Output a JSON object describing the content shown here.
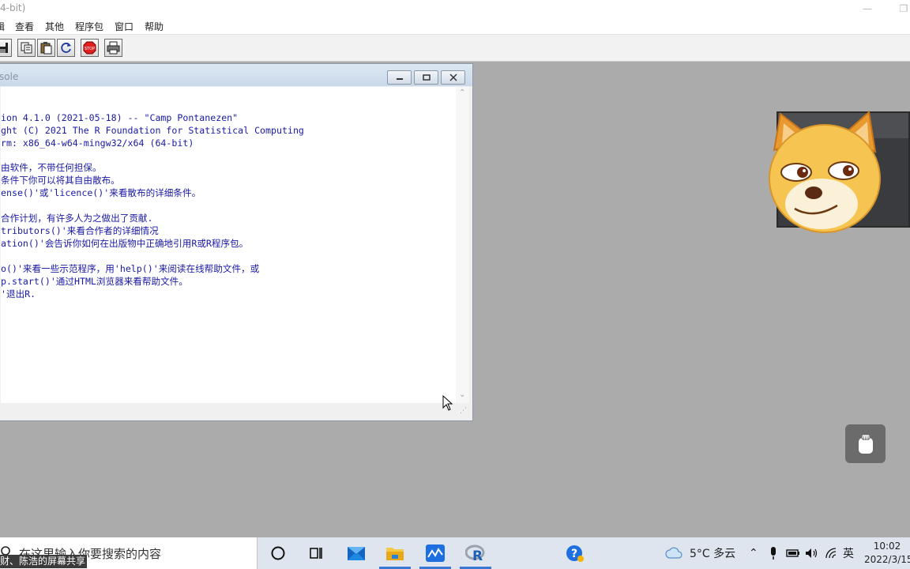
{
  "app": {
    "title_fragment": "4-bit)",
    "accent_color": "#1a1aa6"
  },
  "menu": {
    "items": [
      "辑",
      "查看",
      "其他",
      "程序包",
      "窗口",
      "帮助"
    ]
  },
  "toolbar": {
    "buttons": [
      "save-icon",
      "copy-icon",
      "paste-icon",
      "refresh-icon",
      "stop-icon",
      "print-icon"
    ]
  },
  "console": {
    "title": "sole",
    "lines": [
      "ion 4.1.0 (2021-05-18) -- \"Camp Pontanezen\"",
      "ght (C) 2021 The R Foundation for Statistical Computing",
      "rm: x86_64-w64-mingw32/x64 (64-bit)",
      "",
      "由软件，不带任何担保。",
      "条件下你可以将其自由散布。",
      "ense()'或'licence()'来看散布的详细条件。",
      "",
      "合作计划，有许多人为之做出了贡献.",
      "tributors()'来看合作者的详细情况",
      "ation()'会告诉你如何在出版物中正确地引用R或R程序包。",
      "",
      "o()'来看一些示范程序，用'help()'来阅读在线帮助文件，或",
      "p.start()'通过HTML浏览器来看帮助文件。",
      "'退出R."
    ]
  },
  "taskbar": {
    "search_placeholder": "在这里输入你要搜索的内容",
    "share_note": "财、陈浩的屏幕共享",
    "weather": "5°C 多云",
    "ime": "英",
    "time": "10:02",
    "date": "2022/3/15"
  }
}
